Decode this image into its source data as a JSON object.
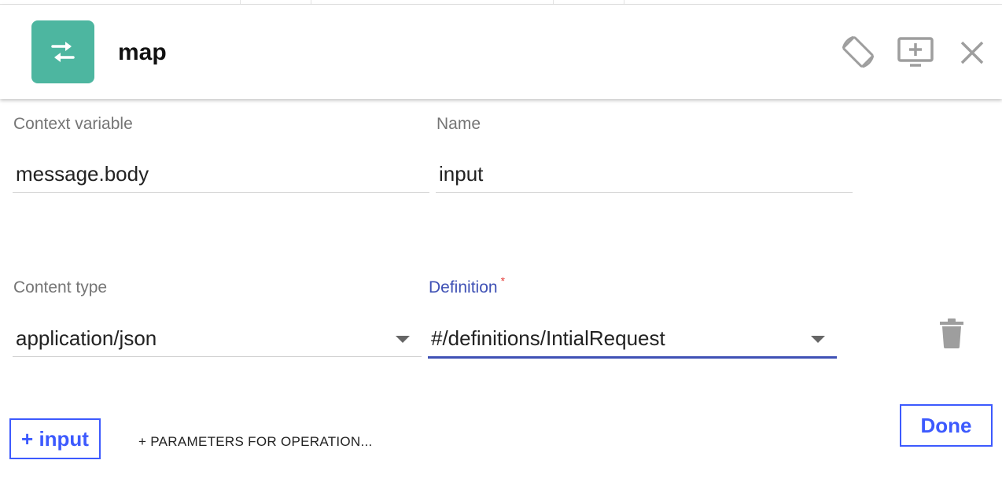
{
  "header": {
    "title": "map",
    "icon": "swap-arrows-icon",
    "accent_color": "#4db6a0",
    "actions": [
      {
        "name": "rotate-screen-icon"
      },
      {
        "name": "add-to-screen-icon"
      },
      {
        "name": "close-icon"
      }
    ]
  },
  "form": {
    "context_variable": {
      "label": "Context variable",
      "value": "message.body"
    },
    "name": {
      "label": "Name",
      "value": "input"
    },
    "content_type": {
      "label": "Content type",
      "value": "application/json"
    },
    "definition": {
      "label": "Definition",
      "required_mark": "*",
      "value": "#/definitions/IntialRequest"
    }
  },
  "actions": {
    "add_input_label": "+ input",
    "params_label": "+ PARAMETERS FOR OPERATION...",
    "done_label": "Done",
    "primary_color": "#3d5afe",
    "focus_color": "#3f51b5"
  }
}
